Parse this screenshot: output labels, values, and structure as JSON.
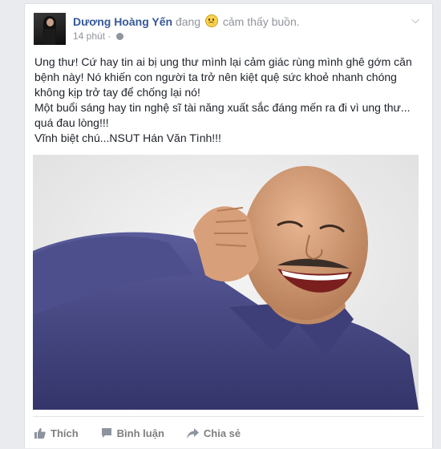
{
  "post": {
    "author": "Dương Hoàng Yến",
    "feeling_prefix": "đang",
    "feeling_emoji": "sad-face-icon",
    "feeling_text": "cảm thấy buồn.",
    "time": "14 phút",
    "separator": "·",
    "visibility_icon": "globe-icon",
    "menu_icon": "chevron-down-icon",
    "paragraphs": [
      "Ung thư! Cứ hay tin ai bị ung thư mình lại cảm giác rùng mình ghê gớm căn bệnh này! Nó khiến con người ta trở nên kiệt quệ sức khoẻ nhanh chóng không kịp trở tay để chống lại nó!",
      "Một buổi sáng hay tin nghệ sĩ tài năng xuất sắc đáng mến ra đi vì ung thư... quá đau lòng!!!",
      "Vĩnh biệt chú...NSUT Hán Văn Tình!!!"
    ]
  },
  "actions": {
    "like": "Thích",
    "comment": "Bình luận",
    "share": "Chia sẻ"
  },
  "colors": {
    "author_link": "#365899",
    "meta_text": "#90949c",
    "shirt": "#4a4b86",
    "page_bg": "#e9ebee"
  }
}
